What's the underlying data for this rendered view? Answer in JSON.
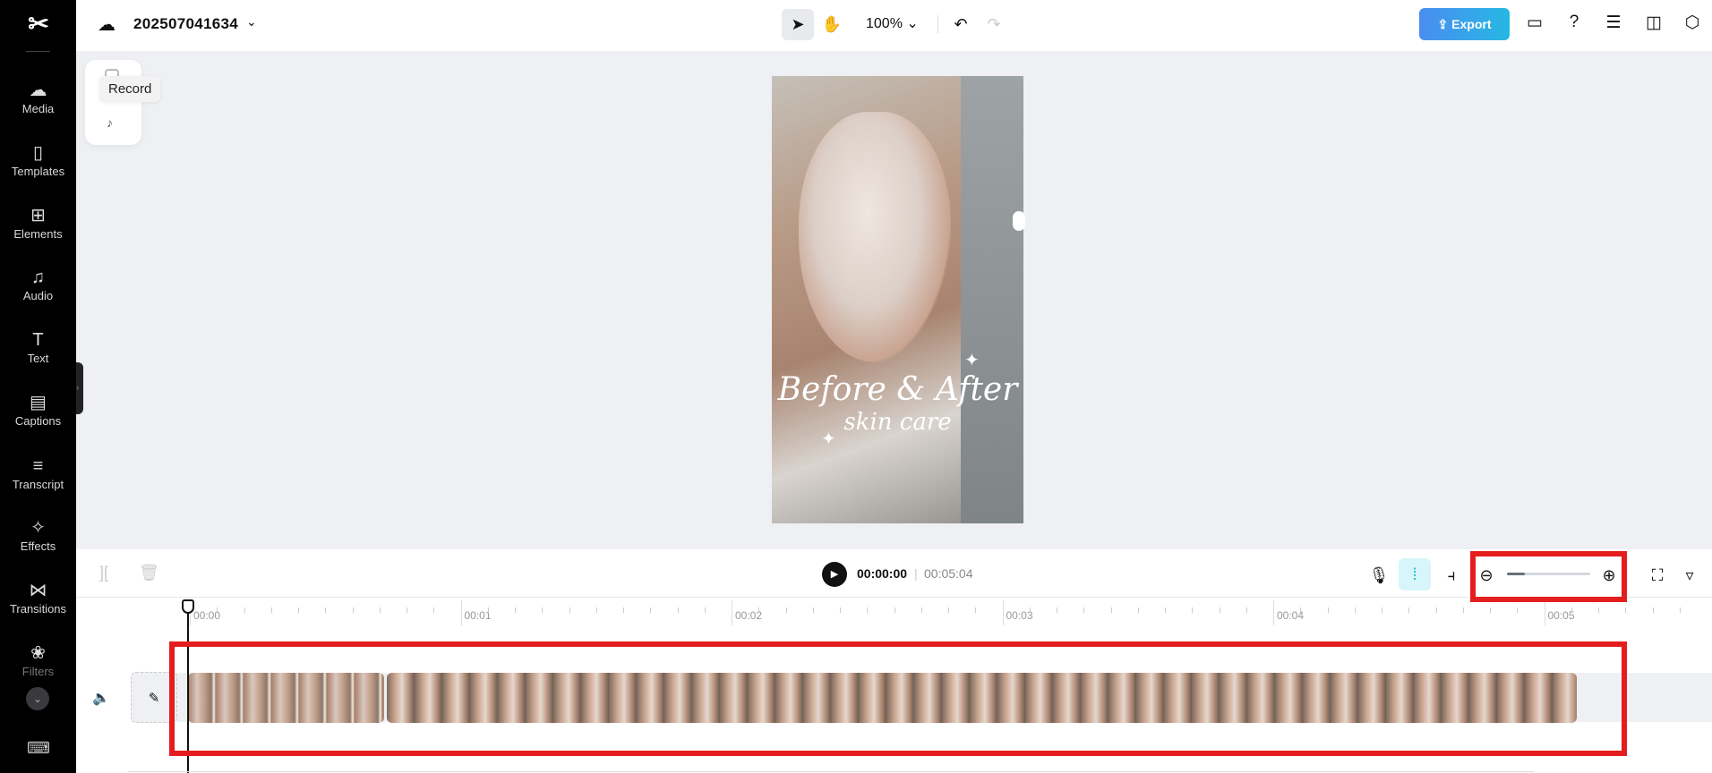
{
  "sidebar": {
    "items": [
      {
        "label": "Media",
        "icon": "cloud-upload-icon"
      },
      {
        "label": "Templates",
        "icon": "templates-icon"
      },
      {
        "label": "Elements",
        "icon": "elements-icon"
      },
      {
        "label": "Audio",
        "icon": "music-note-icon"
      },
      {
        "label": "Text",
        "icon": "text-icon"
      },
      {
        "label": "Captions",
        "icon": "captions-icon"
      },
      {
        "label": "Transcript",
        "icon": "transcript-icon"
      },
      {
        "label": "Effects",
        "icon": "effects-icon"
      },
      {
        "label": "Transitions",
        "icon": "transitions-icon"
      },
      {
        "label": "Filters",
        "icon": "filters-icon"
      }
    ]
  },
  "header": {
    "project_name": "202507041634",
    "zoom_level": "100%",
    "export_label": "Export"
  },
  "float_panel": {
    "tooltip": "Record"
  },
  "preview": {
    "title": "Before & After",
    "subtitle": "skin care"
  },
  "player": {
    "current_time": "00:00:00",
    "separator": "|",
    "total_time": "00:05:04"
  },
  "timeline": {
    "zoom_fraction": 0.22,
    "ruler_labels": [
      "00:00",
      "00:01",
      "00:02",
      "00:03",
      "00:04",
      "00:05"
    ]
  },
  "colors": {
    "accent": "#26b8e3",
    "highlight": "#e41e1e"
  }
}
